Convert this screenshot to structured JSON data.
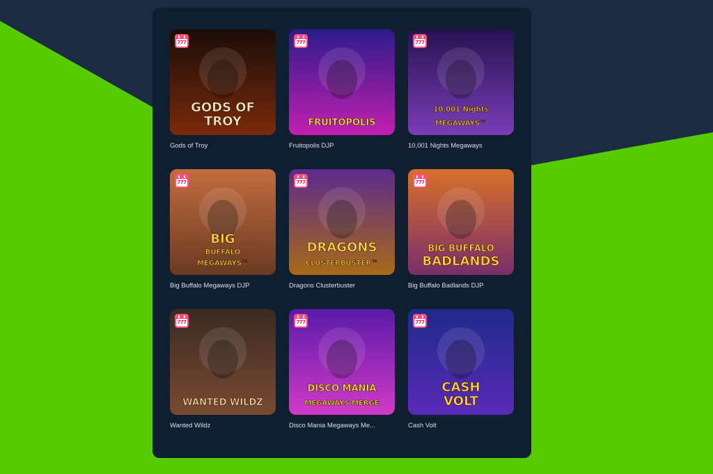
{
  "games": [
    {
      "title": "Gods of Troy",
      "logo": [
        "GODS OF",
        "TROY"
      ],
      "badge": "777",
      "colors": {
        "bg1": "#1a0d08",
        "bg2": "#7a2a0a",
        "text": "#f3e6c8"
      }
    },
    {
      "title": "Fruitopolis DJP",
      "logo": [
        "FRUITOPOLIS"
      ],
      "badge": "777",
      "colors": {
        "bg1": "#2d1b8a",
        "bg2": "#c21fb0",
        "text": "#ffe45a"
      }
    },
    {
      "title": "10,001 Nights Megaways",
      "logo": [
        "10,001 Nights",
        "MEGAWAYS™"
      ],
      "badge": "777",
      "colors": {
        "bg1": "#261250",
        "bg2": "#7a3db8",
        "text": "#f5c84a"
      }
    },
    {
      "title": "Big Buffalo Megaways DJP",
      "logo": [
        "BIG",
        "BUFFALO",
        "MEGAWAYS™"
      ],
      "badge": "777",
      "colors": {
        "bg1": "#c36c3e",
        "bg2": "#6a3a22",
        "text": "#ffd43b"
      }
    },
    {
      "title": "Dragons Clusterbuster",
      "logo": [
        "DRAGONS",
        "CLUSTERBUSTER™"
      ],
      "badge": "777",
      "colors": {
        "bg1": "#5c2a8c",
        "bg2": "#a86a18",
        "text": "#ffd24a"
      }
    },
    {
      "title": "Big Buffalo Badlands DJP",
      "logo": [
        "BIG BUFFALO",
        "BADLANDS"
      ],
      "badge": "777",
      "colors": {
        "bg1": "#d8702a",
        "bg2": "#7a2e6a",
        "text": "#ffd23a"
      }
    },
    {
      "title": "Wanted Wildz",
      "logo": [
        "WANTED WILDZ"
      ],
      "badge": "777",
      "colors": {
        "bg1": "#3a2a22",
        "bg2": "#7a4a32",
        "text": "#f2d8a8"
      }
    },
    {
      "title": "Disco Mania Megaways Me...",
      "logo": [
        "DISCO MANIA",
        "MEGAWAYS MERGE"
      ],
      "badge": "777",
      "colors": {
        "bg1": "#5a1aa8",
        "bg2": "#d23ac8",
        "text": "#ffe23a"
      }
    },
    {
      "title": "Cash Volt",
      "logo": [
        "CASH",
        "VOLT"
      ],
      "badge": "777",
      "colors": {
        "bg1": "#1e2a8a",
        "bg2": "#5a2ab8",
        "text": "#ffd33a"
      }
    }
  ]
}
